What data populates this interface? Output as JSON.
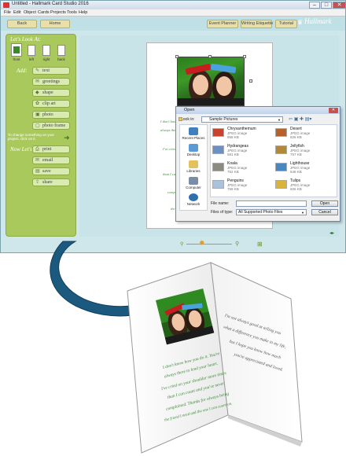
{
  "window": {
    "title": "Untitled - Hallmark Card Studio 2016",
    "controls": [
      "–",
      "□",
      "✕"
    ]
  },
  "menu": [
    "File",
    "Edit",
    "Object",
    "Cards",
    "Projects",
    "Tools",
    "Help"
  ],
  "toolbar": {
    "back": "Back",
    "home": "Home",
    "event_planner": "Event Planner",
    "writing_etiquette": "Writing Etiquette",
    "tutorial": "Tutorial",
    "brand": "Hallmark"
  },
  "left_panel": {
    "look_title": "Let's Look At:",
    "pages": [
      "front",
      "left",
      "right",
      "back"
    ],
    "add_title": "Add:",
    "add_items": [
      {
        "label": "text",
        "icon": "text-icon"
      },
      {
        "label": "greetings",
        "icon": "greetings-icon"
      },
      {
        "label": "shape",
        "icon": "shape-icon"
      },
      {
        "label": "clip art",
        "icon": "clip-art-icon"
      },
      {
        "label": "photo",
        "icon": "photo-icon"
      },
      {
        "label": "photo frame",
        "icon": "photo-frame-icon"
      }
    ],
    "change_note": "To change something on your project, click on it.",
    "now_title": "Now Let's:",
    "now_items": [
      {
        "label": "print",
        "icon": "print-icon"
      },
      {
        "label": "email",
        "icon": "email-icon"
      },
      {
        "label": "save",
        "icon": "save-icon"
      },
      {
        "label": "share",
        "icon": "share-icon"
      }
    ]
  },
  "dialog": {
    "title": "Open",
    "look_in_label": "Look in:",
    "look_in_value": "Sample Pictures",
    "places": [
      "Recent Places",
      "Desktop",
      "Libraries",
      "Computer",
      "Network"
    ],
    "files": [
      {
        "name": "Chrysanthemum",
        "type": "JPEG image",
        "size": "858 KB",
        "color": "#c9442c"
      },
      {
        "name": "Desert",
        "type": "JPEG image",
        "size": "826 KB",
        "color": "#b5612a"
      },
      {
        "name": "Hydrangeas",
        "type": "JPEG image",
        "size": "581 KB",
        "color": "#6c8fc4"
      },
      {
        "name": "Jellyfish",
        "type": "JPEG image",
        "size": "757 KB",
        "color": "#b08a3a"
      },
      {
        "name": "Koala",
        "type": "JPEG image",
        "size": "762 KB",
        "color": "#8b8b82"
      },
      {
        "name": "Lighthouse",
        "type": "JPEG image",
        "size": "548 KB",
        "color": "#4a87c0"
      },
      {
        "name": "Penguins",
        "type": "JPEG image",
        "size": "759 KB",
        "color": "#a9c3dc"
      },
      {
        "name": "Tulips",
        "type": "JPEG image",
        "size": "606 KB",
        "color": "#d8b43a"
      }
    ],
    "file_name_label": "File name:",
    "file_name_value": "",
    "file_type_label": "Files of type:",
    "file_type_value": "All Supported Photo Files",
    "open_label": "Open",
    "cancel_label": "Cancel"
  },
  "card": {
    "left_lines": [
      "I don't know how you do it. You're",
      "always there to lend your heart.",
      "I've cried on your shoulder more times",
      "than I can count and you've never",
      "complained. Thanks for always being",
      "the friend I need and the one I can count on."
    ],
    "right_lines": [
      "I'm not always good at telling you",
      "what a difference you make in my life,",
      "but I hope you know how much",
      "you're appreciated and loved."
    ]
  },
  "colors": {
    "panel_green": "#a9c95c",
    "workspace": "#c9e4e8",
    "arrow_blue": "#1b5a7e",
    "text_green": "#3e8a3a"
  }
}
